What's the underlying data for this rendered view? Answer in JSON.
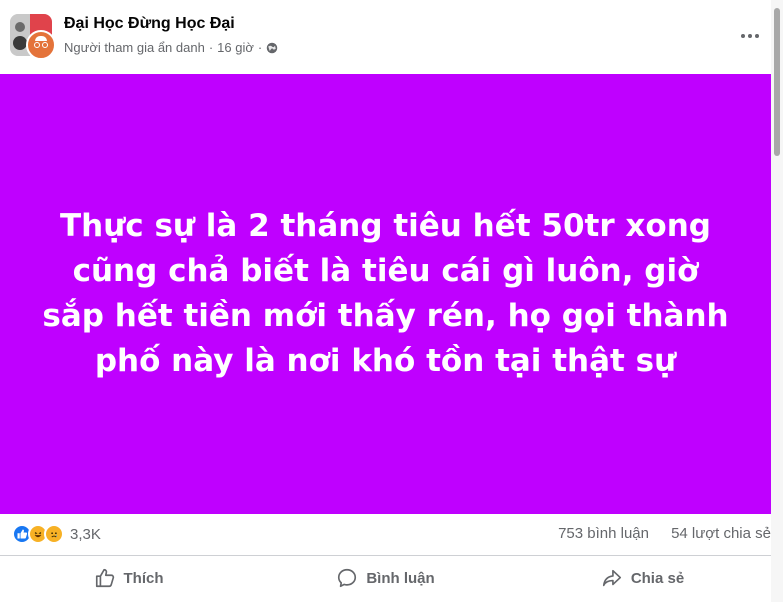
{
  "header": {
    "group_name": "Đại Học Đừng Học Đại",
    "author": "Người tham gia ẩn danh",
    "separator": "·",
    "time": "16 giờ",
    "separator2": "·"
  },
  "icons": {
    "globe": "globe-icon",
    "more": "more-options-icon",
    "like": "like-icon",
    "comment": "comment-icon",
    "share": "share-icon"
  },
  "content": {
    "background_color": "#bf00ff",
    "text": "Thực sự là 2 tháng tiêu hết 50tr xong cũng chả biết là tiêu cái gì luôn, giờ sắp hết tiền mới thấy rén, họ gọi thành phố này là nơi khó tồn tại thật sự"
  },
  "stats": {
    "reaction_types": [
      "like",
      "haha",
      "sad"
    ],
    "reaction_count": "3,3K",
    "comments": "753 bình luận",
    "shares": "54 lượt chia sẻ"
  },
  "actions": {
    "like_label": "Thích",
    "comment_label": "Bình luận",
    "share_label": "Chia sẻ"
  },
  "colors": {
    "accent": "#1877f2",
    "secondary_text": "#65676b"
  }
}
